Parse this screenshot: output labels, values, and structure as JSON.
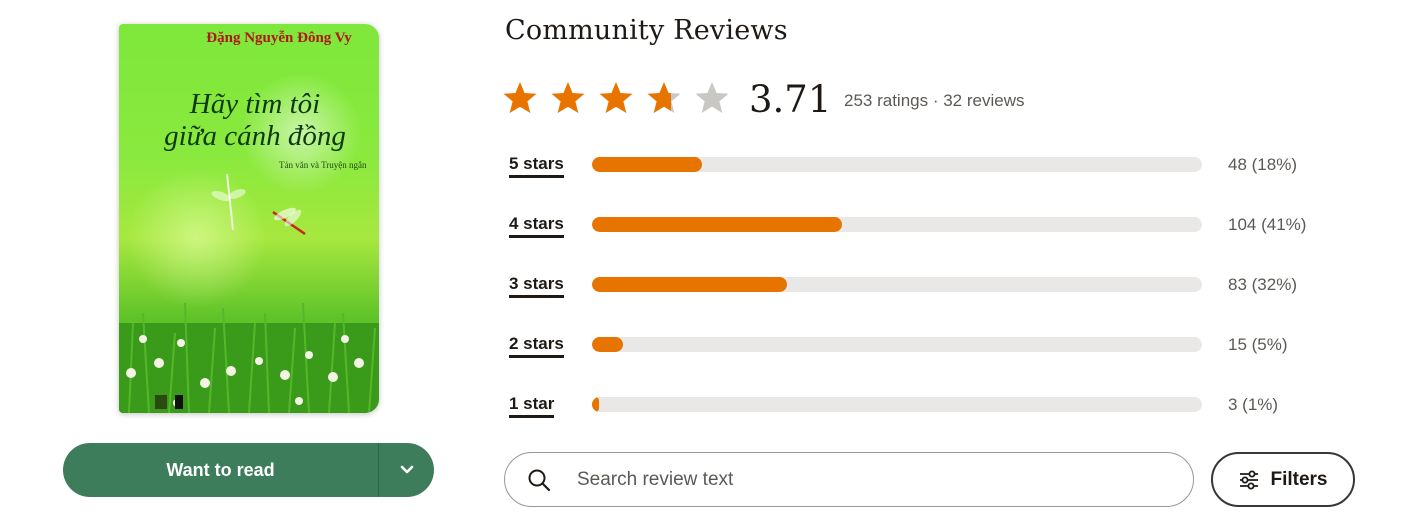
{
  "book": {
    "cover_author": "Đặng Nguyễn Đông Vy",
    "cover_title_line1": "Hãy tìm tôi",
    "cover_title_line2": "giữa cánh đồng",
    "cover_subtitle": "Tản văn và Truyện ngắn"
  },
  "shelf": {
    "button_label": "Want to read",
    "dropdown_icon": "chevron-down-icon",
    "color": "#3e7d5c"
  },
  "reviews": {
    "heading": "Community Reviews",
    "average": "3.71",
    "average_value": 3.71,
    "star_color": "#e87400",
    "counts_text": "253 ratings · 32 reviews",
    "histogram": [
      {
        "label": "5 stars",
        "count_text": "48 (18%)",
        "percent": 18
      },
      {
        "label": "4 stars",
        "count_text": "104 (41%)",
        "percent": 41
      },
      {
        "label": "3 stars",
        "count_text": "83 (32%)",
        "percent": 32
      },
      {
        "label": "2 stars",
        "count_text": "15 (5%)",
        "percent": 5
      },
      {
        "label": "1 star",
        "count_text": "3 (1%)",
        "percent": 1
      }
    ]
  },
  "search": {
    "placeholder": "Search review text",
    "icon": "search-icon"
  },
  "filters": {
    "label": "Filters",
    "icon": "sliders-icon"
  }
}
